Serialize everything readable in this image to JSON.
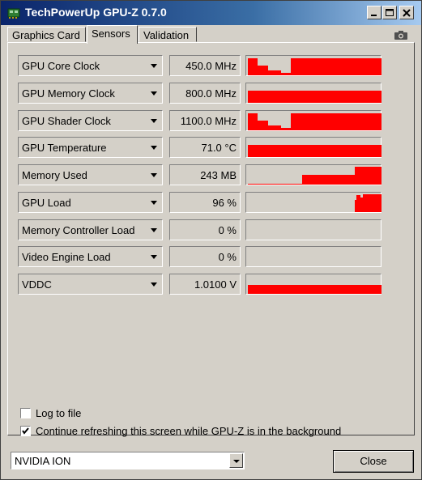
{
  "window": {
    "title": "TechPowerUp GPU-Z 0.7.0"
  },
  "tabs": [
    {
      "label": "Graphics Card"
    },
    {
      "label": "Sensors"
    },
    {
      "label": "Validation"
    }
  ],
  "sensors": [
    {
      "name": "GPU Core Clock",
      "value": "450.0 MHz"
    },
    {
      "name": "GPU Memory Clock",
      "value": "800.0 MHz"
    },
    {
      "name": "GPU Shader Clock",
      "value": "1100.0 MHz"
    },
    {
      "name": "GPU Temperature",
      "value": "71.0 °C"
    },
    {
      "name": "Memory Used",
      "value": "243 MB"
    },
    {
      "name": "GPU Load",
      "value": "96 %"
    },
    {
      "name": "Memory Controller Load",
      "value": "0 %"
    },
    {
      "name": "Video Engine Load",
      "value": "0 %"
    },
    {
      "name": "VDDC",
      "value": "1.0100 V"
    }
  ],
  "options": {
    "log_to_file": {
      "label": "Log to file",
      "checked": false
    },
    "continue_refreshing": {
      "label": "Continue refreshing this screen while GPU-Z is in the background",
      "checked": true
    }
  },
  "gpu_select": {
    "selected": "NVIDIA ION"
  },
  "close_label": "Close",
  "colors": {
    "graph": "#ff0000",
    "titlebar": "#0a246a",
    "face": "#d4d0c8"
  }
}
